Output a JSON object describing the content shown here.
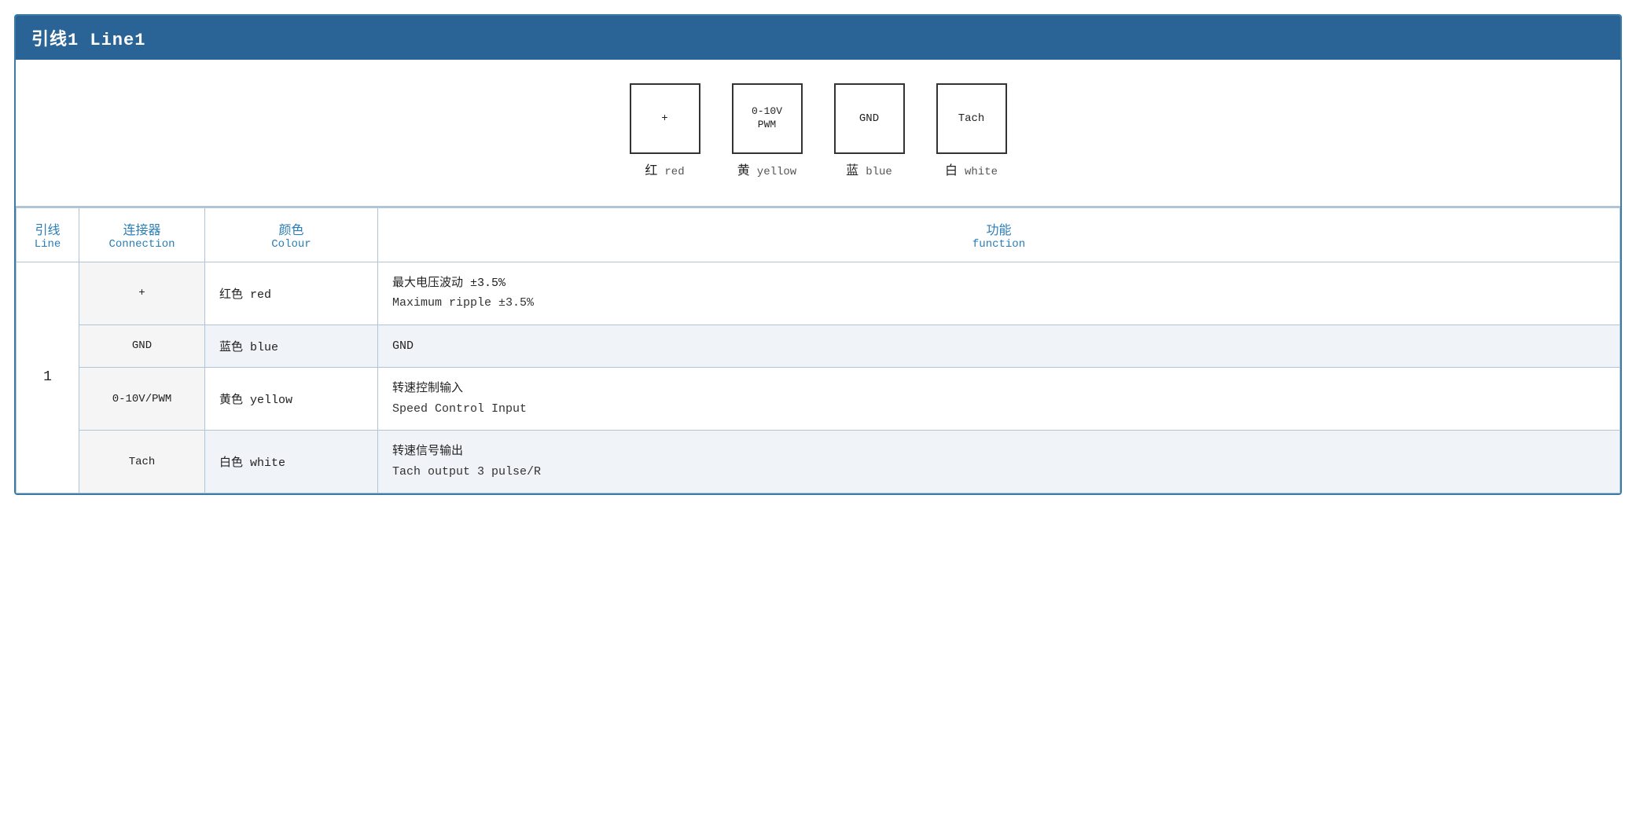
{
  "header": {
    "title": "引线1 Line1"
  },
  "diagram": {
    "connectors": [
      {
        "id": "plus",
        "symbol": "+",
        "cn": "红",
        "en": "red"
      },
      {
        "id": "pwm",
        "symbol": "0-10V\nPWM",
        "cn": "黄",
        "en": "yellow"
      },
      {
        "id": "gnd",
        "symbol": "GND",
        "cn": "蓝",
        "en": "blue"
      },
      {
        "id": "tach",
        "symbol": "Tach",
        "cn": "白",
        "en": "white"
      }
    ]
  },
  "table": {
    "headers": {
      "line_cn": "引线",
      "line_en": "Line",
      "conn_cn": "连接器",
      "conn_en": "Connection",
      "color_cn": "颜色",
      "color_en": "Colour",
      "func_cn": "功能",
      "func_en": "function"
    },
    "rows": [
      {
        "line": "1",
        "conn": "+",
        "color": "红色 red",
        "func_cn": "最大电压波动 ±3.5%",
        "func_en": "Maximum ripple ±3.5%",
        "bg": "light"
      },
      {
        "line": "",
        "conn": "GND",
        "color": "蓝色 blue",
        "func_cn": "GND",
        "func_en": "",
        "bg": "gray"
      },
      {
        "line": "",
        "conn": "0-10V/PWM",
        "color": "黄色 yellow",
        "func_cn": "转速控制输入",
        "func_en": "Speed Control Input",
        "bg": "light"
      },
      {
        "line": "",
        "conn": "Tach",
        "color": "白色 white",
        "func_cn": "转速信号输出",
        "func_en": "Tach output 3 pulse/R",
        "bg": "gray"
      }
    ]
  }
}
